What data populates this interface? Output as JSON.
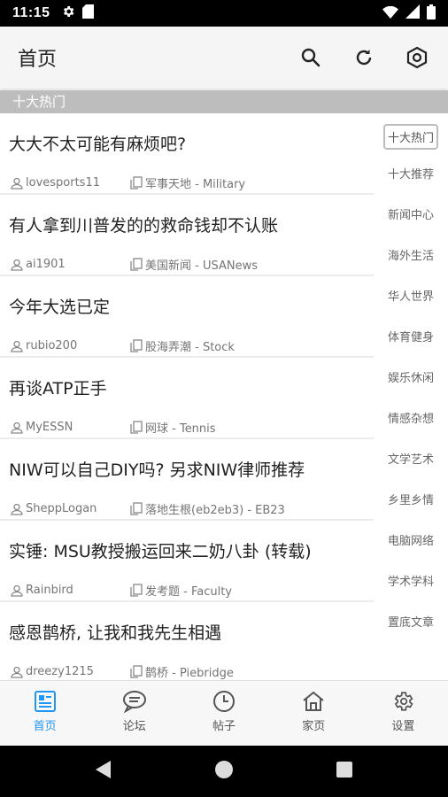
{
  "status_bar": {
    "time": "11:15"
  },
  "app_bar": {
    "title": "首页"
  },
  "section": {
    "title": "十大热门"
  },
  "posts": [
    {
      "title": "大大不太可能有麻烦吧?",
      "author": "lovesports11",
      "board": "军事天地 - Military"
    },
    {
      "title": "有人拿到川普发的的救命钱却不认账",
      "author": "ai1901",
      "board": "美国新闻 - USANews"
    },
    {
      "title": "今年大选已定",
      "author": "rubio200",
      "board": "股海弄潮 - Stock"
    },
    {
      "title": "再谈ATP正手",
      "author": "MyESSN",
      "board": "网球 - Tennis"
    },
    {
      "title": "NIW可以自己DIY吗? 另求NIW律师推荐",
      "author": "SheppLogan",
      "board": "落地生根(eb2eb3) - EB23"
    },
    {
      "title": "实锤: MSU教授搬运回来二奶八卦 (转载)",
      "author": "Rainbird",
      "board": "发考题 - Faculty"
    },
    {
      "title": "感恩鹊桥, 让我和我先生相遇",
      "author": "dreezy1215",
      "board": "鹊桥 - Piebridge"
    }
  ],
  "categories": [
    "十大热门",
    "十大推荐",
    "新闻中心",
    "海外生活",
    "华人世界",
    "体育健身",
    "娱乐休闲",
    "情感杂想",
    "文学艺术",
    "乡里乡情",
    "电脑网络",
    "学术学科",
    "置底文章"
  ],
  "selected_category": "十大热门",
  "bottom_nav": [
    {
      "label": "首页",
      "icon": "home-list-icon",
      "active": true
    },
    {
      "label": "论坛",
      "icon": "chat-bubble-icon",
      "active": false
    },
    {
      "label": "帖子",
      "icon": "clock-icon",
      "active": false
    },
    {
      "label": "家页",
      "icon": "house-icon",
      "active": false
    },
    {
      "label": "设置",
      "icon": "gear-icon",
      "active": false
    }
  ],
  "colors": {
    "accent": "#2196f3",
    "section_header_bg": "#bdbdbd",
    "app_bar_bg": "#f5f5f5"
  }
}
